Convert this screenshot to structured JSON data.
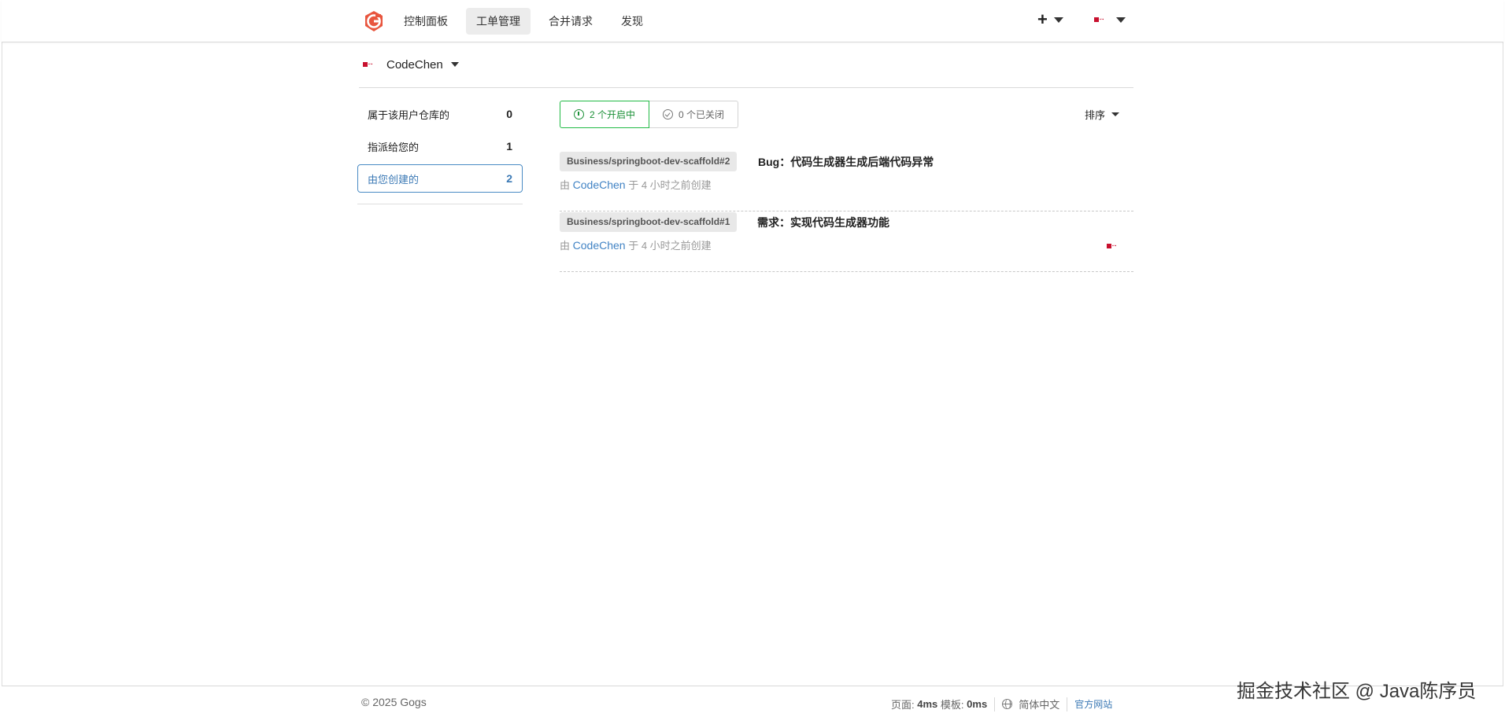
{
  "header": {
    "nav": [
      "控制面板",
      "工单管理",
      "合并请求",
      "发现"
    ],
    "active_nav": "工单管理",
    "create_label": "+"
  },
  "context": {
    "user": "CodeChen"
  },
  "filters": [
    {
      "label": "属于该用户仓库的",
      "count": "0"
    },
    {
      "label": "指派给您的",
      "count": "1"
    },
    {
      "label": "由您创建的",
      "count": "2"
    }
  ],
  "states": {
    "open": "2 个开启中",
    "closed": "0 个已关闭"
  },
  "sort_label": "排序",
  "issues": [
    {
      "repo": "Business/springboot-dev-scaffold#2",
      "title": "Bug：代码生成器生成后端代码异常",
      "by": "由",
      "author": "CodeChen",
      "time": "于 4 小时之前创建"
    },
    {
      "repo": "Business/springboot-dev-scaffold#1",
      "title": "需求：实现代码生成器功能",
      "by": "由",
      "author": "CodeChen",
      "time": "于 4 小时之前创建"
    }
  ],
  "footer": {
    "copyright": "© 2025 Gogs",
    "page_label": "页面:",
    "page_time": "4ms",
    "tpl_label": "模板:",
    "tpl_time": "0ms",
    "language": "简体中文",
    "site": "官方网站"
  },
  "watermark": "掘金技术社区 @ Java陈序员",
  "colors": {
    "brand": "#e8553e",
    "accent": "#3b79b5",
    "open_green": "#21ba45"
  }
}
